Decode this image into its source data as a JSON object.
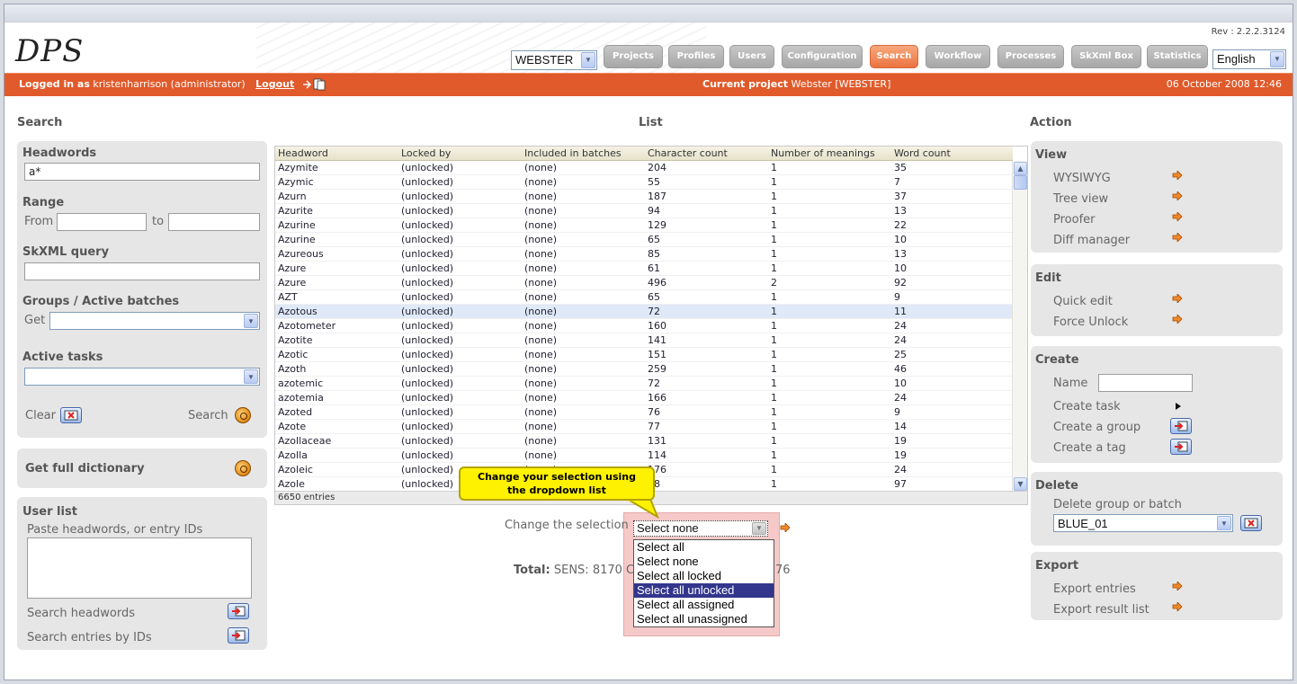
{
  "app": {
    "logo": "DPS",
    "revision": "Rev : 2.2.2.3124",
    "project_select": "WEBSTER",
    "language_select": "English"
  },
  "nav": [
    {
      "label": "Projects"
    },
    {
      "label": "Profiles"
    },
    {
      "label": "Users"
    },
    {
      "label": "Configuration"
    },
    {
      "label": "Search"
    },
    {
      "label": "Workflow"
    },
    {
      "label": "Processes"
    },
    {
      "label": "SkXml Box"
    },
    {
      "label": "Statistics"
    }
  ],
  "status_bar": {
    "logged_in_label": "Logged in as",
    "user": "kristenharrison (administrator)",
    "logout": "Logout",
    "current_project_label": "Current project",
    "current_project": "Webster [WEBSTER]",
    "datetime": "06 October 2008 12:46"
  },
  "sections": {
    "search": "Search",
    "list": "List",
    "action": "Action"
  },
  "search_panel": {
    "headwords_label": "Headwords",
    "headwords_value": "a*",
    "range_label": "Range",
    "from_label": "From",
    "to_label": "to",
    "skxml_label": "SkXML query",
    "groups_label": "Groups / Active batches",
    "get_label": "Get",
    "active_tasks_label": "Active tasks",
    "clear_label": "Clear",
    "search_label": "Search"
  },
  "full_dict": {
    "label": "Get full dictionary"
  },
  "user_list": {
    "title": "User list",
    "hint": "Paste headwords, or entry IDs",
    "search_headwords": "Search headwords",
    "search_ids": "Search entries by IDs"
  },
  "table": {
    "headers": [
      "Headword",
      "Locked by",
      "Included in batches",
      "Character count",
      "Number of meanings",
      "Word count"
    ],
    "rows": [
      [
        "Azymite",
        "(unlocked)",
        "(none)",
        "204",
        "1",
        "35"
      ],
      [
        "Azymic",
        "(unlocked)",
        "(none)",
        "55",
        "1",
        "7"
      ],
      [
        "Azurn",
        "(unlocked)",
        "(none)",
        "187",
        "1",
        "37"
      ],
      [
        "Azurite",
        "(unlocked)",
        "(none)",
        "94",
        "1",
        "13"
      ],
      [
        "Azurine",
        "(unlocked)",
        "(none)",
        "129",
        "1",
        "22"
      ],
      [
        "Azurine",
        "(unlocked)",
        "(none)",
        "65",
        "1",
        "10"
      ],
      [
        "Azureous",
        "(unlocked)",
        "(none)",
        "85",
        "1",
        "13"
      ],
      [
        "Azure",
        "(unlocked)",
        "(none)",
        "61",
        "1",
        "10"
      ],
      [
        "Azure",
        "(unlocked)",
        "(none)",
        "496",
        "2",
        "92"
      ],
      [
        "AZT",
        "(unlocked)",
        "(none)",
        "65",
        "1",
        "9"
      ],
      [
        "Azotous",
        "(unlocked)",
        "(none)",
        "72",
        "1",
        "11"
      ],
      [
        "Azotometer",
        "(unlocked)",
        "(none)",
        "160",
        "1",
        "24"
      ],
      [
        "Azotite",
        "(unlocked)",
        "(none)",
        "141",
        "1",
        "24"
      ],
      [
        "Azotic",
        "(unlocked)",
        "(none)",
        "151",
        "1",
        "25"
      ],
      [
        "Azoth",
        "(unlocked)",
        "(none)",
        "259",
        "1",
        "46"
      ],
      [
        "azotemic",
        "(unlocked)",
        "(none)",
        "72",
        "1",
        "10"
      ],
      [
        "azotemia",
        "(unlocked)",
        "(none)",
        "166",
        "1",
        "24"
      ],
      [
        "Azoted",
        "(unlocked)",
        "(none)",
        "76",
        "1",
        "9"
      ],
      [
        "Azote",
        "(unlocked)",
        "(none)",
        "77",
        "1",
        "14"
      ],
      [
        "Azollaceae",
        "(unlocked)",
        "(none)",
        "131",
        "1",
        "19"
      ],
      [
        "Azolla",
        "(unlocked)",
        "(none)",
        "114",
        "1",
        "19"
      ],
      [
        "Azoleic",
        "(unlocked)",
        "(none)",
        "176",
        "1",
        "24"
      ],
      [
        "Azole",
        "(unlocked)",
        "(none)",
        "58",
        "1",
        "97"
      ]
    ],
    "selected_row": 10,
    "footer": "6650 entries"
  },
  "callout": {
    "line1": "Change your selection using",
    "line2": "the dropdown list"
  },
  "selection": {
    "label": "Change the selection",
    "value": "Select none",
    "options": [
      "Select all",
      "Select none",
      "Select all locked",
      "Select all unlocked",
      "Select all assigned",
      "Select all unassigned"
    ],
    "highlighted": 3
  },
  "total": {
    "label": "Total:",
    "prefix": "SENS: 8170 C",
    "suffix": "76"
  },
  "action": {
    "view_title": "View",
    "view_items": [
      "WYSIWYG",
      "Tree view",
      "Proofer",
      "Diff manager"
    ],
    "edit_title": "Edit",
    "edit_items": [
      "Quick edit",
      "Force Unlock"
    ],
    "create_title": "Create",
    "name_label": "Name",
    "create_task": "Create task",
    "create_group": "Create a group",
    "create_tag": "Create a tag",
    "delete_title": "Delete",
    "delete_label": "Delete group or batch",
    "delete_select": "BLUE_01",
    "export_title": "Export",
    "export_entries": "Export entries",
    "export_result": "Export result list"
  },
  "colors": {
    "accent": "#e05a2b",
    "panel": "#e6e6e6",
    "highlight": "#33368c",
    "callout": "#fff200"
  }
}
